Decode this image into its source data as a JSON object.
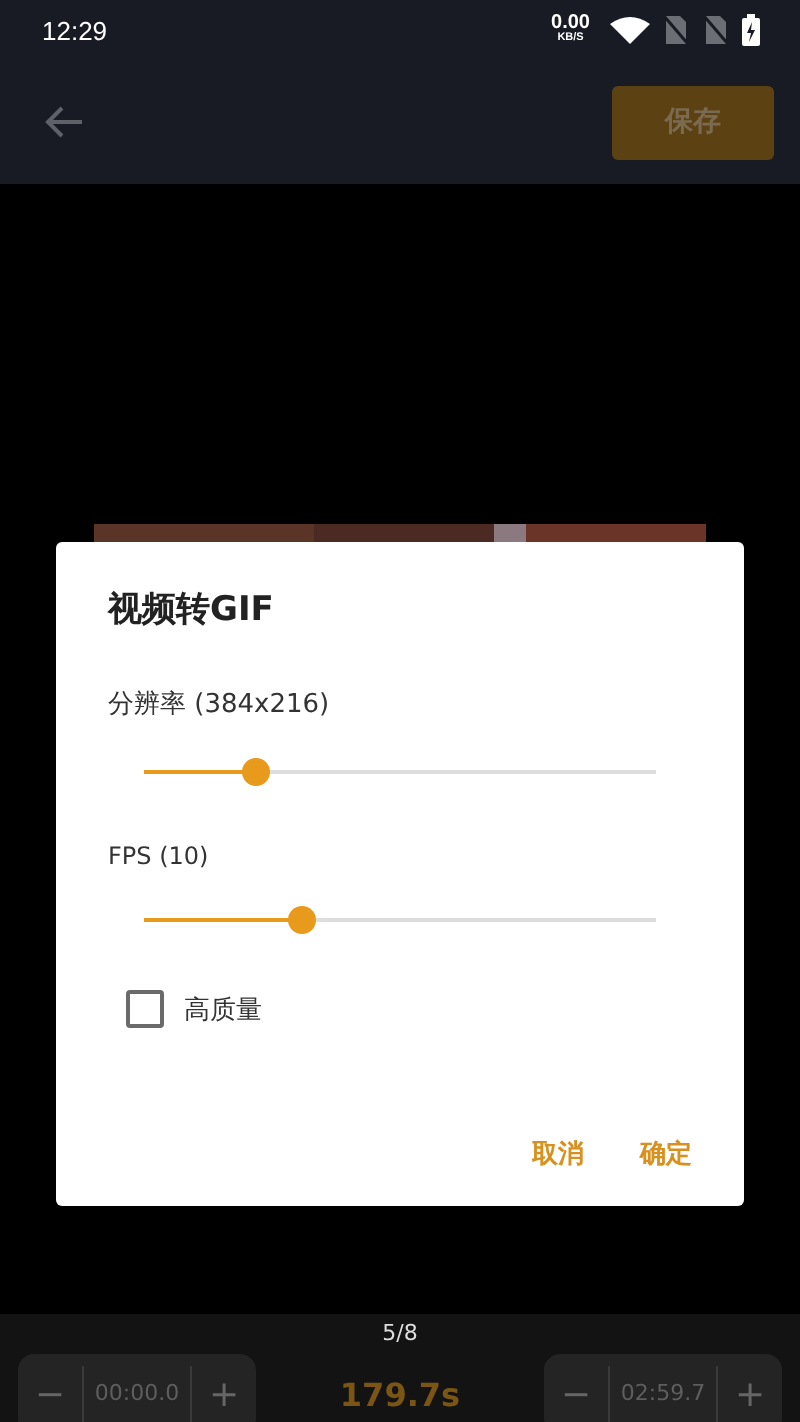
{
  "status_bar": {
    "time": "12:29",
    "net_speed": "0.00",
    "net_unit": "KB/S"
  },
  "app_bar": {
    "save_button": {
      "label": "保存",
      "disabled": true
    }
  },
  "dialog": {
    "title": "视频转GIF",
    "sliders": [
      {
        "label": "分辨率 (384x216)",
        "level": 0.22
      },
      {
        "label": "FPS (10)",
        "level": 0.31
      }
    ],
    "checkbox": {
      "label": "高质量",
      "checked": false
    },
    "buttons": [
      "取消",
      "确定"
    ]
  },
  "bottom_bar": {
    "page": "5/8",
    "duration": "179.7s",
    "start": {
      "minus": "−",
      "value": "00:00.0",
      "plus": "+"
    },
    "end": {
      "minus": "−",
      "value": "02:59.7",
      "plus": "+"
    }
  }
}
